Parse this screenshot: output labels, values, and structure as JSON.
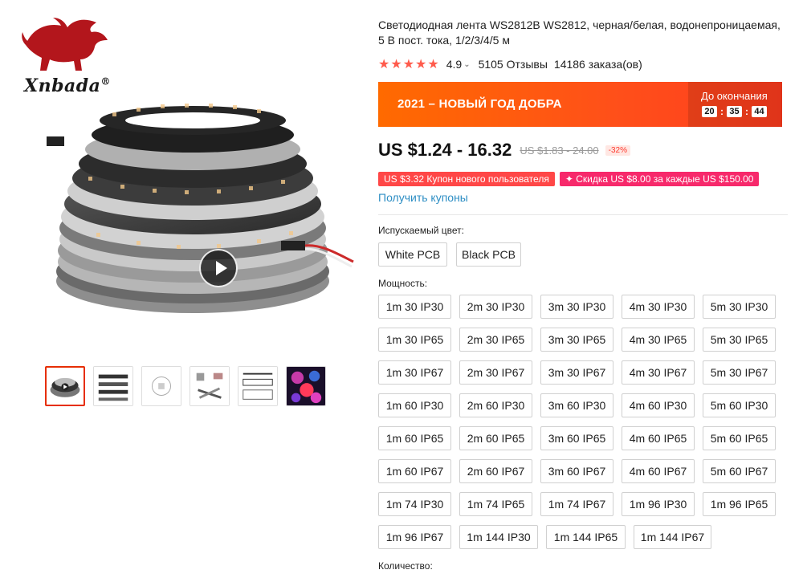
{
  "brand": {
    "name": "Xnbada",
    "reg": "®"
  },
  "product": {
    "title": "Светодиодная лента WS2812B WS2812, черная/белая, водонепроницаемая, 5 В пост. тока, 1/2/3/4/5 м",
    "rating": "4.9",
    "stars": "★★★★★",
    "reviews": "5105 Отзывы",
    "orders": "14186 заказа(ов)"
  },
  "promo": {
    "label": "2021 – НОВЫЙ ГОД ДОБРА",
    "countdown_label": "До окончания",
    "hours": "20",
    "minutes": "35",
    "seconds": "44"
  },
  "price": {
    "current": "US $1.24 - 16.32",
    "old": "US $1.83 - 24.00",
    "discount": "-32%"
  },
  "coupons": {
    "new_user": "US $3.32 Купон нового пользователя",
    "discount": "✦ Скидка US $8.00 за каждые US $150.00",
    "get": "Получить купоны"
  },
  "color_section": {
    "label": "Испускаемый цвет:",
    "options": [
      "White PCB",
      "Black PCB"
    ]
  },
  "power_section": {
    "label": "Мощность:",
    "options": [
      "1m 30 IP30",
      "2m 30 IP30",
      "3m 30 IP30",
      "4m 30 IP30",
      "5m 30 IP30",
      "1m 30 IP65",
      "2m 30 IP65",
      "3m 30 IP65",
      "4m 30 IP65",
      "5m 30 IP65",
      "1m 30 IP67",
      "2m 30 IP67",
      "3m 30 IP67",
      "4m 30 IP67",
      "5m 30 IP67",
      "1m 60 IP30",
      "2m 60 IP30",
      "3m 60 IP30",
      "4m 60 IP30",
      "5m 60 IP30",
      "1m 60 IP65",
      "2m 60 IP65",
      "3m 60 IP65",
      "4m 60 IP65",
      "5m 60 IP65",
      "1m 60 IP67",
      "2m 60 IP67",
      "3m 60 IP67",
      "4m 60 IP67",
      "5m 60 IP67",
      "1m 74 IP30",
      "1m 74 IP65",
      "1m 74 IP67",
      "1m 96 IP30",
      "1m 96 IP65",
      "1m 96 IP67",
      "1m 144 IP30",
      "1m 144 IP65",
      "1m 144 IP67"
    ]
  },
  "quantity_section": {
    "label": "Количество:"
  },
  "colors": {
    "accent": "#ff4f1a",
    "star": "#ff5b4c",
    "link": "#2d8ec4",
    "coupon_red": "#ff4747",
    "coupon_pink": "#f7296b"
  }
}
